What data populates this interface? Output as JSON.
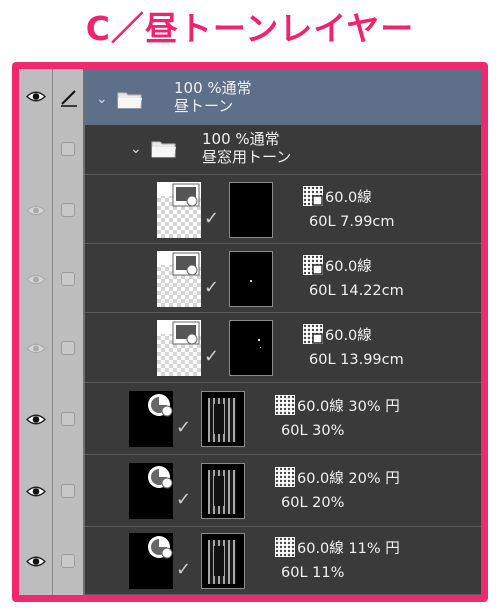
{
  "title": "C／昼トーンレイヤー",
  "colors": {
    "accent": "#f0286e",
    "panel_bg": "#3a3a3a",
    "selected_bg": "#5d6f89"
  },
  "group1": {
    "line1": "100 %通常",
    "line2": "昼トーン"
  },
  "group2": {
    "line1": "100 %通常",
    "line2": "昼窓用トーン"
  },
  "layers": [
    {
      "line1": "60.0線",
      "line2": "60L 7.99cm"
    },
    {
      "line1": "60.0線",
      "line2": "60L 14.22cm"
    },
    {
      "line1": "60.0線",
      "line2": "60L 13.99cm"
    },
    {
      "line1": "60.0線 30% 円",
      "line2": "60L 30%"
    },
    {
      "line1": "60.0線 20% 円",
      "line2": "60L 20%"
    },
    {
      "line1": "60.0線 11% 円",
      "line2": "60L 11%"
    }
  ]
}
